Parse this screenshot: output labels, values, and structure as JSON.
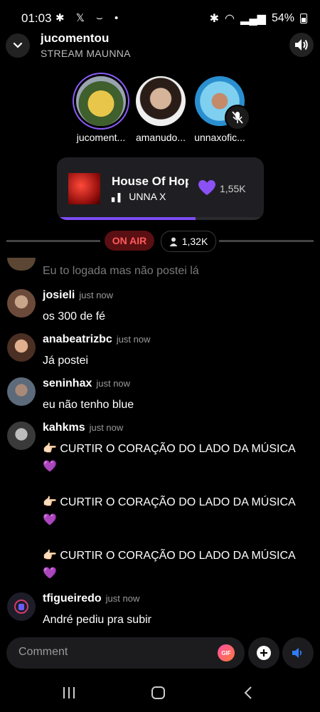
{
  "status_bar": {
    "time": "01:03",
    "battery": "54%"
  },
  "header": {
    "title": "jucomentou",
    "subtitle": "STREAM MAUNNA"
  },
  "speakers": [
    {
      "name": "jucoment..."
    },
    {
      "name": "amanudo..."
    },
    {
      "name": "unnaxofic..."
    }
  ],
  "now_playing": {
    "song": "House Of Hope",
    "artist": "UNNA X",
    "likes": "1,55K",
    "progress": 0.67
  },
  "room": {
    "on_air_label": "ON AIR",
    "listeners": "1,32K"
  },
  "chat": {
    "partial_message": "Eu to logada mas não postei lá",
    "messages": [
      {
        "user": "josieli",
        "time": "just now",
        "lines": [
          "os 300 de fé"
        ]
      },
      {
        "user": "anabeatrizbc",
        "time": "just now",
        "lines": [
          "Já postei"
        ]
      },
      {
        "user": "seninhax",
        "time": "just now",
        "lines": [
          "eu não tenho blue"
        ]
      },
      {
        "user": "kahkms",
        "time": "just now",
        "lines": [
          "👉🏻 CURTIR O CORAÇÃO DO LADO DA MÚSICA",
          "💜",
          "",
          "👉🏻 CURTIR O CORAÇÃO DO LADO DA MÚSICA",
          "💜",
          "",
          "👉🏻 CURTIR O CORAÇÃO DO LADO DA MÚSICA",
          "💜"
        ]
      },
      {
        "user": "tfigueiredo",
        "time": "just now",
        "lines": [
          "André pediu pra subir"
        ]
      }
    ]
  },
  "composer": {
    "placeholder": "Comment",
    "gif_label": "GIF"
  },
  "colors": {
    "accent": "#7d4cf6",
    "on_air": "#ff5a5a"
  }
}
